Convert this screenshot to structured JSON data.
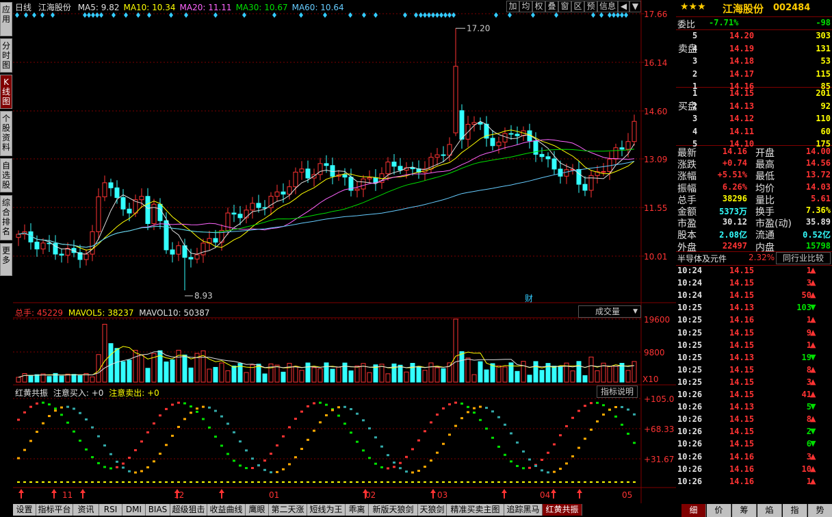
{
  "left_tabs": [
    "应用",
    "分时图",
    "K线图",
    "个股资料",
    "自选股",
    "综合排名",
    "更多"
  ],
  "toolbar": [
    "加",
    "均",
    "权",
    "叠",
    "窗",
    "区",
    "预",
    "信息"
  ],
  "chart_title": {
    "period": "日线",
    "stock": "江海股份",
    "ma": [
      {
        "label": "MA5: 9.82",
        "color": "#e0e0e0"
      },
      {
        "label": "MA10: 10.34",
        "color": "#ffff00"
      },
      {
        "label": "MA20: 11.11",
        "color": "#ff66ff"
      },
      {
        "label": "MA30: 10.67",
        "color": "#00e000"
      },
      {
        "label": "MA60: 10.64",
        "color": "#66ccff"
      }
    ]
  },
  "price_axis": [
    "17.66",
    "16.14",
    "14.60",
    "13.09",
    "11.55",
    "10.01"
  ],
  "annotations": {
    "high": "17.20",
    "low": "8.93",
    "cai": "财"
  },
  "volume_header": {
    "label": "总手: 45229",
    "mavol5": "MAVOL5: 38237",
    "mavol10": "MAVOL10: 50387",
    "selector": "成交量"
  },
  "volume_axis": [
    "19600",
    "9800",
    "X10"
  ],
  "indicator_header": {
    "name": "红黄共振",
    "buy": "注意买入: +0",
    "sell": "注意卖出: +0",
    "explain": "指标说明"
  },
  "indicator_axis": [
    "+105.0",
    "+68.33",
    "+31.67"
  ],
  "date_axis": [
    "11",
    "12",
    "01",
    "02",
    "03",
    "04",
    "05"
  ],
  "bottom_tabs": [
    "设置",
    "指标平台",
    "资讯",
    "RSI",
    "DMI",
    "BIAS",
    "超级狙击",
    "收益曲线",
    "鹰眼",
    "第二天涨",
    "短线为王",
    "乖离",
    "新版天狼剑",
    "天狼剑",
    "精准买卖主图",
    "追踪黑马",
    "红黄共振"
  ],
  "right_bottom_tabs": [
    "细",
    "价",
    "筹",
    "焰",
    "指",
    "势"
  ],
  "quote": {
    "name": "江海股份",
    "code": "002484",
    "weibi_label": "委比",
    "weibi": "-7.71%",
    "weicha": "-98",
    "sell_label": "卖盘",
    "buy_label": "买盘",
    "sells": [
      {
        "lvl": "5",
        "price": "14.20",
        "vol": "303"
      },
      {
        "lvl": "4",
        "price": "14.19",
        "vol": "131"
      },
      {
        "lvl": "3",
        "price": "14.18",
        "vol": "53"
      },
      {
        "lvl": "2",
        "price": "14.17",
        "vol": "115"
      },
      {
        "lvl": "1",
        "price": "14.16",
        "vol": "85"
      }
    ],
    "buys": [
      {
        "lvl": "1",
        "price": "14.15",
        "vol": "201"
      },
      {
        "lvl": "2",
        "price": "14.13",
        "vol": "92"
      },
      {
        "lvl": "3",
        "price": "14.12",
        "vol": "110"
      },
      {
        "lvl": "4",
        "price": "14.11",
        "vol": "60"
      },
      {
        "lvl": "5",
        "price": "14.10",
        "vol": "175"
      }
    ],
    "stats": [
      {
        "l1": "最新",
        "v1": "14.16",
        "c1": "red",
        "l2": "开盘",
        "v2": "14.00",
        "c2": "red"
      },
      {
        "l1": "涨跌",
        "v1": "+0.74",
        "c1": "red",
        "l2": "最高",
        "v2": "14.56",
        "c2": "red"
      },
      {
        "l1": "涨幅",
        "v1": "+5.51%",
        "c1": "red",
        "l2": "最低",
        "v2": "13.72",
        "c2": "red"
      },
      {
        "l1": "振幅",
        "v1": "6.26%",
        "c1": "red",
        "l2": "均价",
        "v2": "14.03",
        "c2": "red"
      },
      {
        "l1": "总手",
        "v1": "38296",
        "c1": "yel",
        "l2": "量比",
        "v2": "5.61",
        "c2": "red"
      },
      {
        "l1": "金额",
        "v1": "5373万",
        "c1": "cyan",
        "l2": "换手",
        "v2": "7.36%",
        "c2": "yel"
      },
      {
        "l1": "市盈",
        "v1": "30.12",
        "c1": "wht",
        "l2": "市盈(动)",
        "v2": "35.89",
        "c2": "wht"
      },
      {
        "l1": "股本",
        "v1": "2.08亿",
        "c1": "cyan",
        "l2": "流通",
        "v2": "0.52亿",
        "c2": "cyan"
      },
      {
        "l1": "外盘",
        "v1": "22497",
        "c1": "red",
        "l2": "内盘",
        "v2": "15798",
        "c2": "grn"
      }
    ],
    "industry": {
      "name": "半导体及元件",
      "pct": "2.32%",
      "compare": "同行业比较"
    },
    "ticks": [
      {
        "t": "10:24",
        "p": "14.15",
        "v": "1",
        "d": "up"
      },
      {
        "t": "10:24",
        "p": "14.15",
        "v": "3",
        "d": "up"
      },
      {
        "t": "10:24",
        "p": "14.15",
        "v": "50",
        "d": "up"
      },
      {
        "t": "10:25",
        "p": "14.13",
        "v": "103",
        "d": "down"
      },
      {
        "t": "10:25",
        "p": "14.16",
        "v": "1",
        "d": "up"
      },
      {
        "t": "10:25",
        "p": "14.15",
        "v": "9",
        "d": "up"
      },
      {
        "t": "10:25",
        "p": "14.15",
        "v": "1",
        "d": "up"
      },
      {
        "t": "10:25",
        "p": "14.13",
        "v": "19",
        "d": "down"
      },
      {
        "t": "10:25",
        "p": "14.15",
        "v": "8",
        "d": "up"
      },
      {
        "t": "10:25",
        "p": "14.15",
        "v": "3",
        "d": "up"
      },
      {
        "t": "10:26",
        "p": "14.15",
        "v": "41",
        "d": "up"
      },
      {
        "t": "10:26",
        "p": "14.13",
        "v": "5",
        "d": "down"
      },
      {
        "t": "10:26",
        "p": "14.15",
        "v": "8",
        "d": "up"
      },
      {
        "t": "10:26",
        "p": "14.15",
        "v": "2",
        "d": "down"
      },
      {
        "t": "10:26",
        "p": "14.15",
        "v": "6",
        "d": "down"
      },
      {
        "t": "10:26",
        "p": "14.16",
        "v": "3",
        "d": "up"
      },
      {
        "t": "10:26",
        "p": "14.16",
        "v": "10",
        "d": "up"
      },
      {
        "t": "10:26",
        "p": "14.16",
        "v": "1",
        "d": "up"
      }
    ]
  },
  "colors": {
    "up": "#ff3333",
    "down": "#33ffff",
    "grid": "#800000",
    "bg": "#000000"
  }
}
